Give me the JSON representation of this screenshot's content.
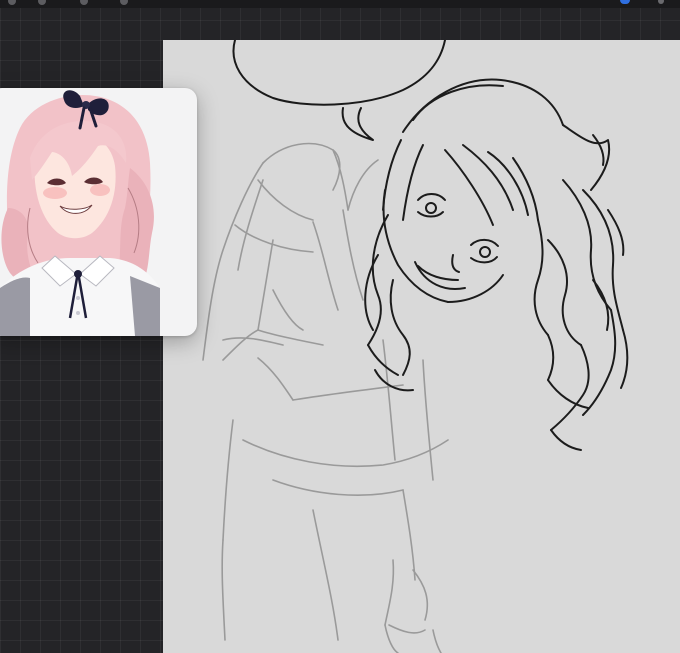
{
  "app": {
    "canvas_color": "#d9d9d9",
    "workspace_color": "#242427",
    "accent_color": "#2f6fe0"
  },
  "toolbar": {
    "icons": [
      "gallery-icon",
      "actions-icon",
      "adjustments-icon",
      "selection-icon",
      "color-icon"
    ]
  },
  "reference_window": {
    "visible": true,
    "content": "colored-character-reference"
  }
}
